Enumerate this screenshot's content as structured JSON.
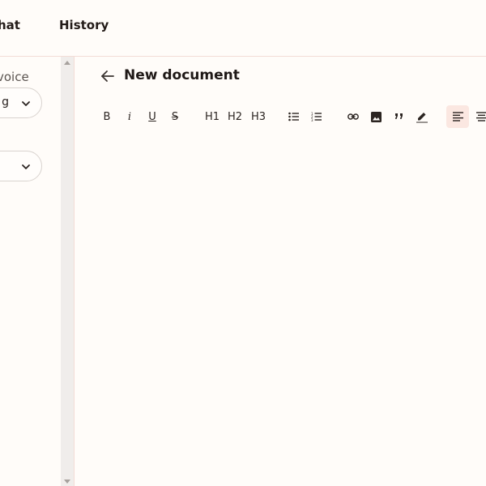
{
  "topbar": {
    "tabs": [
      {
        "label": "hat"
      },
      {
        "label": "History"
      }
    ]
  },
  "sidebar": {
    "voice_label": "voice",
    "voice_select": {
      "value": "g"
    },
    "second_select": {
      "value": ""
    }
  },
  "editor": {
    "title": "New document",
    "toolbar": {
      "bold": "B",
      "italic": "i",
      "underline": "U",
      "strike": "S",
      "h1": "H1",
      "h2": "H2",
      "h3": "H3"
    },
    "body": ""
  },
  "colors": {
    "background": "#fffcf9",
    "border": "#f3dcd6",
    "active_button": "#fbe7e1",
    "text": "#1f1a17"
  }
}
